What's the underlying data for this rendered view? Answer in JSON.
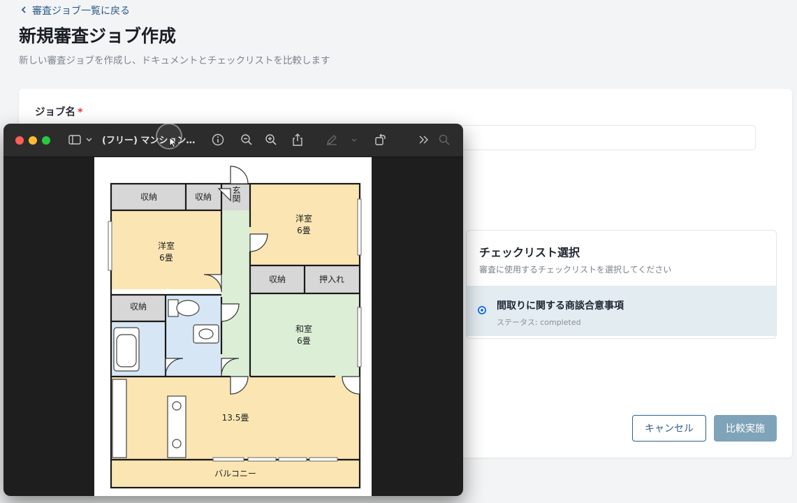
{
  "page": {
    "back_link": "審査ジョブ一覧に戻る",
    "title": "新規審査ジョブ作成",
    "subtitle": "新しい審査ジョブを作成し、ドキュメントとチェックリストを比較します"
  },
  "form": {
    "job_name_label": "ジョブ名",
    "required_mark": "*",
    "job_name_value": ""
  },
  "checklist": {
    "title": "チェックリスト選択",
    "description": "審査に使用するチェックリストを選択してください",
    "options": [
      {
        "name": "間取りに関する商談合意事項",
        "status": "ステータス: completed",
        "selected": true
      }
    ]
  },
  "actions": {
    "cancel": "キャンセル",
    "compare": "比較実施"
  },
  "preview": {
    "window_title": "(フリー) マンション...",
    "toolbar_icons": [
      "sidebar-icon",
      "chevron-down-icon",
      "info-icon",
      "zoom-out-icon",
      "zoom-in-icon",
      "share-icon",
      "markup-pen-icon",
      "chevron-down-icon",
      "rotate-icon",
      "more-icon",
      "search-icon"
    ],
    "floorplan": {
      "storage_1": "収納",
      "storage_2": "収納",
      "entrance": "玄関",
      "western_room_1": "洋室",
      "western_room_1_size": "6畳",
      "western_room_2": "洋室",
      "western_room_2_size": "6畳",
      "storage_3": "収納",
      "closet": "押入れ",
      "storage_4": "収納",
      "japanese_room": "和室",
      "japanese_room_size": "6畳",
      "living_size": "13.5畳",
      "balcony": "バルコニー"
    }
  },
  "colors": {
    "accent": "#2c5a8a",
    "required": "#d9363e",
    "selected_row": "#e3ecf1",
    "compare_button": "#7fa3b8",
    "room_yellow": "#fbe6b3",
    "room_green": "#dcefd6",
    "room_blue": "#d6e6f5",
    "storage_gray": "#d7d7d7"
  }
}
